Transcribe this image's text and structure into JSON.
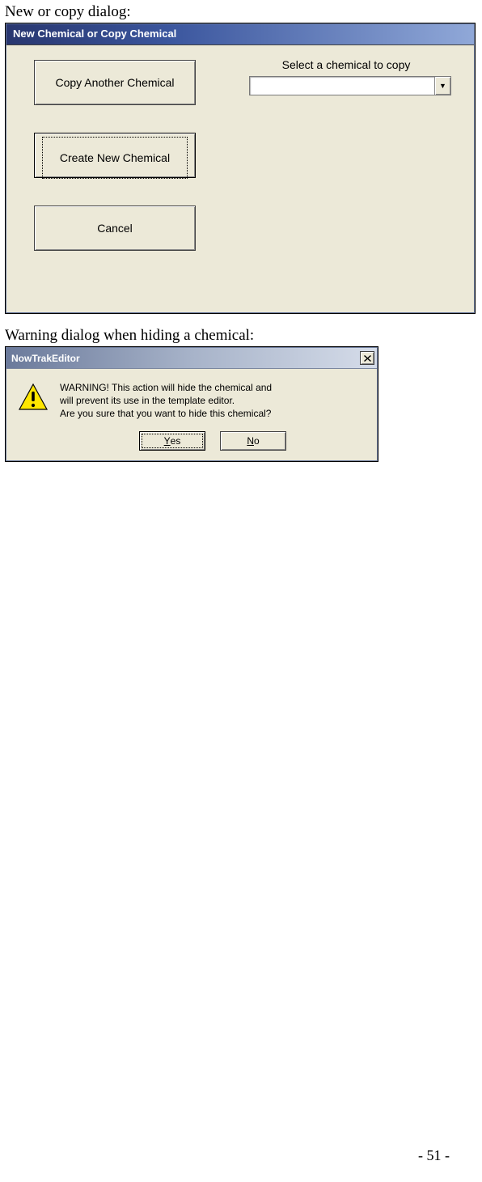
{
  "caption1": "New or copy dialog:",
  "dialog1": {
    "title": "New Chemical or Copy Chemical",
    "copy_btn": "Copy Another Chemical",
    "create_btn": "Create New Chemical",
    "cancel_btn": "Cancel",
    "select_label": "Select a chemical to copy",
    "combo_value": ""
  },
  "caption2": "Warning dialog when hiding a chemical:",
  "dialog2": {
    "title": "NowTrakEditor",
    "line1": "WARNING! This action will hide the chemical and",
    "line2": "will prevent its use in the template editor.",
    "line3": "Are you sure that you want to hide this chemical?",
    "yes_u": "Y",
    "yes_rest": "es",
    "no_u": "N",
    "no_rest": "o"
  },
  "page_number": "- 51 -"
}
